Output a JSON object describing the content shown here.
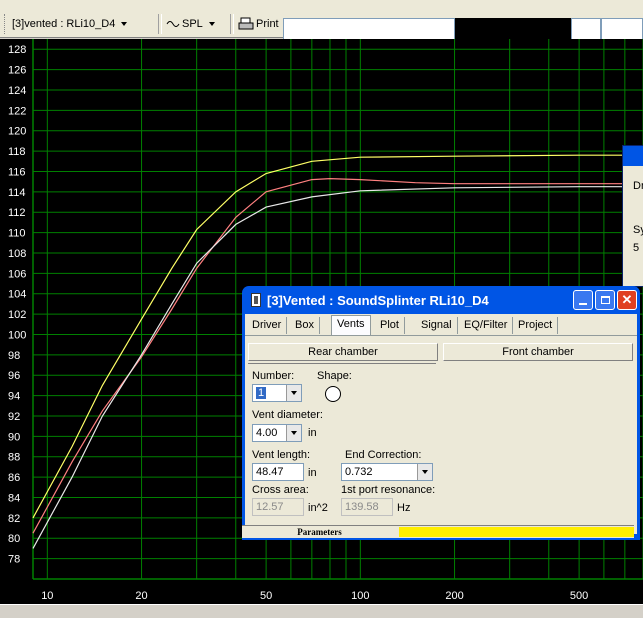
{
  "toolbar": {
    "project_select": "[3]vented : RLi10_D4",
    "mode_select": "SPL",
    "print_label": "Print"
  },
  "graph": {
    "y_ticks": [
      "128",
      "126",
      "124",
      "122",
      "120",
      "118",
      "116",
      "114",
      "112",
      "110",
      "108",
      "106",
      "104",
      "102",
      "100",
      "98",
      "96",
      "94",
      "92",
      "90",
      "88",
      "86",
      "84",
      "82",
      "80",
      "78"
    ],
    "x_ticks": [
      "10",
      "20",
      "50",
      "100",
      "200",
      "500"
    ],
    "colors": {
      "background": "#000000",
      "grid": "#008000",
      "label": "#ffffff",
      "yellow": "#ffff66",
      "pink": "#ff8080",
      "white": "#e8e8e8"
    }
  },
  "chart_data": {
    "type": "line",
    "x_scale": "log",
    "xlim": [
      9,
      800
    ],
    "ylim": [
      76,
      129
    ],
    "series": [
      {
        "color": "#ffff66",
        "points": [
          [
            9,
            82
          ],
          [
            12,
            89
          ],
          [
            15,
            95
          ],
          [
            20,
            101.5
          ],
          [
            25,
            106.5
          ],
          [
            30,
            110.3
          ],
          [
            40,
            114
          ],
          [
            50,
            115.8
          ],
          [
            70,
            117
          ],
          [
            100,
            117.4
          ],
          [
            200,
            117.5
          ],
          [
            500,
            117.6
          ],
          [
            800,
            117.6
          ]
        ]
      },
      {
        "color": "#ff8080",
        "points": [
          [
            9,
            80.5
          ],
          [
            12,
            87.5
          ],
          [
            15,
            92.5
          ],
          [
            20,
            97.8
          ],
          [
            25,
            102.5
          ],
          [
            30,
            106.5
          ],
          [
            40,
            111.5
          ],
          [
            50,
            114
          ],
          [
            70,
            115.2
          ],
          [
            80,
            115.3
          ],
          [
            100,
            115.2
          ],
          [
            150,
            114.9
          ],
          [
            200,
            114.8
          ],
          [
            500,
            114.8
          ],
          [
            800,
            114.8
          ]
        ]
      },
      {
        "color": "#e8e8e8",
        "points": [
          [
            9,
            79
          ],
          [
            12,
            86
          ],
          [
            15,
            92
          ],
          [
            20,
            98
          ],
          [
            25,
            103
          ],
          [
            30,
            107
          ],
          [
            40,
            110.8
          ],
          [
            50,
            112.5
          ],
          [
            70,
            113.5
          ],
          [
            100,
            114.1
          ],
          [
            200,
            114.4
          ],
          [
            500,
            114.5
          ],
          [
            800,
            114.5
          ]
        ]
      }
    ]
  },
  "dialog": {
    "title": "[3]Vented : SoundSplinter RLi10_D4",
    "tabs": [
      "Driver",
      "Box",
      "Vents",
      "Plot",
      "Signal",
      "EQ/Filter",
      "Project"
    ],
    "rear_chamber": "Rear chamber",
    "front_chamber": "Front chamber",
    "number_label": "Number:",
    "number_value": "1",
    "shape_label": "Shape:",
    "vent_diameter_label": "Vent diameter:",
    "vent_diameter_value": "4.00",
    "vent_diameter_unit": "in",
    "vent_length_label": "Vent length:",
    "vent_length_value": "48.47",
    "vent_length_unit": "in",
    "end_correction_label": "End Correction:",
    "end_correction_value": "0.732",
    "cross_area_label": "Cross area:",
    "cross_area_value": "12.57",
    "cross_area_unit": "in^2",
    "port_resonance_label": "1st port resonance:",
    "port_resonance_value": "139.58",
    "port_resonance_unit": "Hz",
    "status_label": "Parameters"
  },
  "bg_window": {
    "labels": [
      "Dr",
      "Sy",
      "5"
    ]
  }
}
